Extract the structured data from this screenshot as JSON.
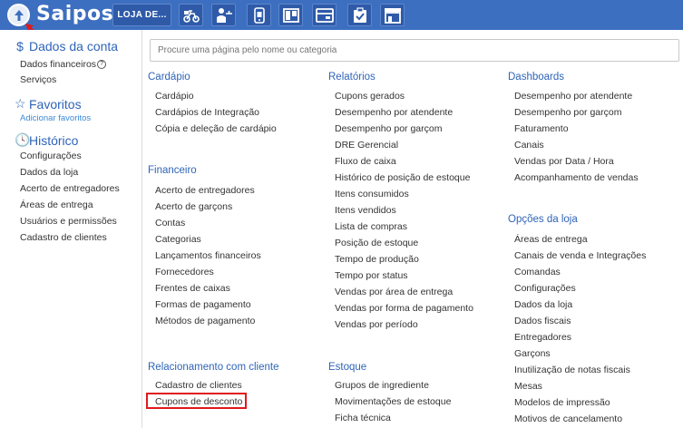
{
  "topbar": {
    "logo_text": "Saipos",
    "store_label": "LOJA DE...",
    "icons": [
      "delivery-icon",
      "waiter-icon",
      "phone-icon",
      "board-icon",
      "kiosk-icon",
      "clipboard-check-icon",
      "store-icon"
    ],
    "accent": "#3d6fc0"
  },
  "search": {
    "placeholder": "Procure uma página pelo nome ou categoria"
  },
  "sidebar": {
    "account": {
      "title": "Dados da conta",
      "items": [
        "Dados financeiros",
        "Serviços"
      ]
    },
    "favorites": {
      "title": "Favoritos",
      "link": "Adicionar favoritos"
    },
    "history": {
      "title": "Histórico",
      "items": [
        "Configurações",
        "Dados da loja",
        "Acerto de entregadores",
        "Áreas de entrega",
        "Usuários e permissões",
        "Cadastro de clientes"
      ]
    }
  },
  "columns": {
    "cardapio": {
      "title": "Cardápio",
      "items": [
        "Cardápio",
        "Cardápios de Integração",
        "Cópia e deleção de cardápio"
      ]
    },
    "financeiro": {
      "title": "Financeiro",
      "items": [
        "Acerto de entregadores",
        "Acerto de garçons",
        "Contas",
        "Categorias",
        "Lançamentos financeiros",
        "Fornecedores",
        "Frentes de caixas",
        "Formas de pagamento",
        "Métodos de pagamento"
      ]
    },
    "relacionamento": {
      "title": "Relacionamento com cliente",
      "items": [
        "Cadastro de clientes",
        "Cupons de desconto"
      ]
    },
    "relatorios": {
      "title": "Relatórios",
      "items": [
        "Cupons gerados",
        "Desempenho por atendente",
        "Desempenho por garçom",
        "DRE Gerencial",
        "Fluxo de caixa",
        "Histórico de posição de estoque",
        "Itens consumidos",
        "Itens vendidos",
        "Lista de compras",
        "Posição de estoque",
        "Tempo de produção",
        "Tempo por status",
        "Vendas por área de entrega",
        "Vendas por forma de pagamento",
        "Vendas por período"
      ]
    },
    "estoque": {
      "title": "Estoque",
      "items": [
        "Grupos de ingrediente",
        "Movimentações de estoque",
        "Ficha técnica"
      ]
    },
    "dashboards": {
      "title": "Dashboards",
      "items": [
        "Desempenho por atendente",
        "Desempenho por garçom",
        "Faturamento",
        "Canais",
        "Vendas por Data / Hora",
        "Acompanhamento de vendas"
      ]
    },
    "opcoes": {
      "title": "Opções da loja",
      "items": [
        "Áreas de entrega",
        "Canais de venda e Integrações",
        "Comandas",
        "Configurações",
        "Dados da loja",
        "Dados fiscais",
        "Entregadores",
        "Garçons",
        "Inutilização de notas fiscais",
        "Mesas",
        "Modelos de impressão",
        "Motivos de cancelamento"
      ]
    }
  }
}
